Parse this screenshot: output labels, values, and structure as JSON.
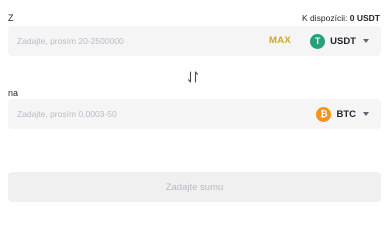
{
  "from": {
    "label": "Z",
    "available_label": "K dispozícii:",
    "available_value": "0 USDT",
    "placeholder": "Zadajte, prosím 20-2500000",
    "max_label": "MAX",
    "coin": {
      "symbol": "USDT",
      "icon": "usdt-icon",
      "icon_glyph": "T",
      "color": "#26a17b"
    }
  },
  "swap": {
    "icon": "swap-arrows-icon"
  },
  "to": {
    "label": "na",
    "placeholder": "Zadajte, prosím 0.0003-50",
    "coin": {
      "symbol": "BTC",
      "icon": "btc-icon",
      "icon_glyph": "₿",
      "color": "#f7931a"
    }
  },
  "submit": {
    "label": "Zadajte sumu",
    "enabled": false
  },
  "colors": {
    "accent": "#d0a52c",
    "field_bg": "#f5f5f5",
    "placeholder": "#b7bdc6",
    "button_disabled_bg": "#f0f0f0"
  }
}
